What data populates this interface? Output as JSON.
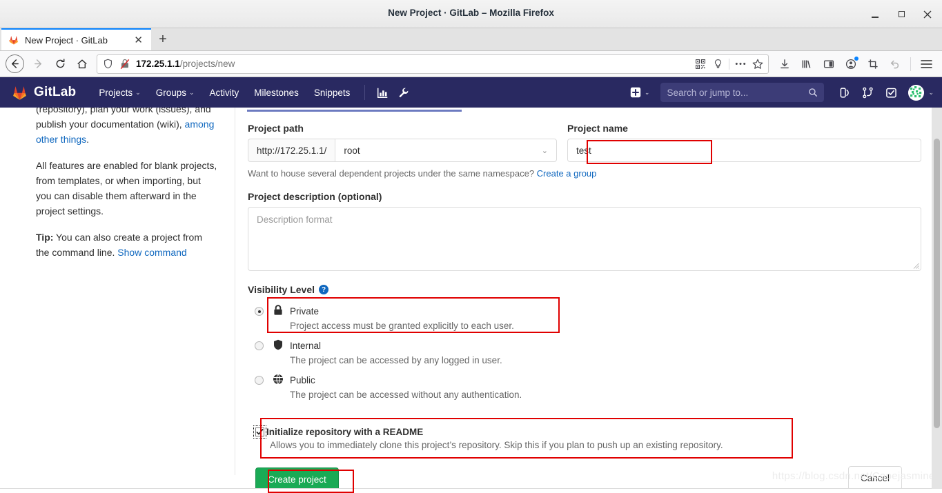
{
  "window": {
    "title": "New Project · GitLab – Mozilla Firefox",
    "minimize": "–",
    "maximize": "□",
    "close": "✕"
  },
  "browser": {
    "tab": {
      "label": "New Project · GitLab",
      "close": "✕",
      "new_tab": "+"
    },
    "url": {
      "host": "172.25.1.1",
      "path": "/projects/new"
    },
    "nav": {
      "back": "←",
      "forward": "→",
      "reload": "⟳",
      "home": "⌂"
    },
    "toolbar_icons": [
      "qr-code-icon",
      "lightbulb-icon",
      "page-actions-icon",
      "bookmark-star-icon",
      "downloads-icon",
      "library-icon",
      "sidebar-icon",
      "account-icon",
      "screenshot-icon",
      "undo-icon",
      "menu-icon"
    ]
  },
  "gitlab_header": {
    "brand": "GitLab",
    "nav_items": [
      {
        "label": "Projects",
        "has_caret": true
      },
      {
        "label": "Groups",
        "has_caret": true
      },
      {
        "label": "Activity",
        "has_caret": false
      },
      {
        "label": "Milestones",
        "has_caret": false
      },
      {
        "label": "Snippets",
        "has_caret": false
      }
    ],
    "icon_buttons": [
      "analytics-icon",
      "wrench-icon"
    ],
    "search_placeholder": "Search or jump to...",
    "right_icons": [
      "plus-icon",
      "issues-icon",
      "merge-requests-icon",
      "todos-icon"
    ],
    "caret": "⌄"
  },
  "aside": {
    "paragraph1_pre": "(repository), plan your work (issues), and publish your documentation (wiki), ",
    "paragraph1_link": "among other things",
    "paragraph1_post": ".",
    "paragraph2": "All features are enabled for blank projects, from templates, or when importing, but you can disable them afterward in the project settings.",
    "tip_label": "Tip:",
    "tip_text": " You can also create a project from the command line. ",
    "tip_link": "Show command"
  },
  "form": {
    "project_path": {
      "label": "Project path",
      "prefix": "http://172.25.1.1/",
      "namespace": "root",
      "chevron": "⌄"
    },
    "project_name": {
      "label": "Project name",
      "value": "test"
    },
    "hint_text": "Want to house several dependent projects under the same namespace? ",
    "hint_link": "Create a group",
    "description": {
      "label": "Project description (optional)",
      "placeholder": "Description format"
    },
    "visibility": {
      "label": "Visibility Level",
      "help_glyph": "?",
      "options": [
        {
          "title": "Private",
          "desc": "Project access must be granted explicitly to each user.",
          "icon": "lock-icon",
          "selected": true
        },
        {
          "title": "Internal",
          "desc": "The project can be accessed by any logged in user.",
          "icon": "shield-icon",
          "selected": false
        },
        {
          "title": "Public",
          "desc": "The project can be accessed without any authentication.",
          "icon": "globe-icon",
          "selected": false
        }
      ]
    },
    "readme": {
      "label": "Initialize repository with a README",
      "desc": "Allows you to immediately clone this project’s repository. Skip this if you plan to push up an existing repository.",
      "checked": true,
      "check_glyph": "✔"
    },
    "create_button": "Create project",
    "cancel_button": "Cancel"
  },
  "watermark": "https://blog.csdn.net/CapejasmineY",
  "colors": {
    "gitlab_navy": "#292961",
    "accent_green": "#1aaa55",
    "link_blue": "#1068bf",
    "annotation_red": "#e00000",
    "tab_underline": "#6c7ac0"
  }
}
